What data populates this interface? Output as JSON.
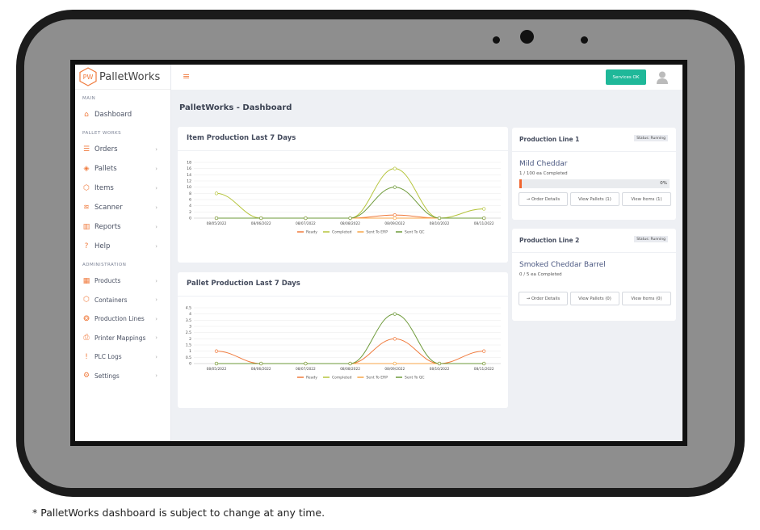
{
  "app": {
    "brand": "PalletWorks",
    "logo_letters": "PW",
    "page_title": "PalletWorks - Dashboard",
    "services_status": "Services OK"
  },
  "sidebar": {
    "sections": [
      {
        "label": "MAIN",
        "items": [
          {
            "label": "Dashboard",
            "icon": "home-icon",
            "glyph": "⌂"
          }
        ]
      },
      {
        "label": "PALLET WORKS",
        "items": [
          {
            "label": "Orders",
            "icon": "orders-icon",
            "glyph": "☰"
          },
          {
            "label": "Pallets",
            "icon": "layers-icon",
            "glyph": "◈"
          },
          {
            "label": "Items",
            "icon": "box-icon",
            "glyph": "⬡"
          },
          {
            "label": "Scanner",
            "icon": "rss-icon",
            "glyph": "≋"
          },
          {
            "label": "Reports",
            "icon": "bar-chart-icon",
            "glyph": "▥"
          },
          {
            "label": "Help",
            "icon": "help-icon",
            "glyph": "?"
          }
        ]
      },
      {
        "label": "ADMINISTRATION",
        "items": [
          {
            "label": "Products",
            "icon": "grid-icon",
            "glyph": "▦"
          },
          {
            "label": "Containers",
            "icon": "box-icon",
            "glyph": "⬡"
          },
          {
            "label": "Production Lines",
            "icon": "globe-icon",
            "glyph": "❂"
          },
          {
            "label": "Printer Mappings",
            "icon": "printer-icon",
            "glyph": "⎙"
          },
          {
            "label": "PLC Logs",
            "icon": "alert-icon",
            "glyph": "!"
          },
          {
            "label": "Settings",
            "icon": "gear-icon",
            "glyph": "⚙"
          }
        ]
      }
    ]
  },
  "chart_data": [
    {
      "type": "line",
      "title": "Item Production Last 7 Days",
      "categories": [
        "08/05/2022",
        "08/06/2022",
        "08/07/2022",
        "08/08/2022",
        "08/09/2022",
        "08/10/2022",
        "08/11/2022"
      ],
      "ylim": [
        0,
        18
      ],
      "yticks": [
        0,
        2,
        4,
        6,
        8,
        10,
        12,
        14,
        16,
        18
      ],
      "grid": true,
      "legend": "bottom",
      "series": [
        {
          "name": "Ready",
          "color": "#f07a3c",
          "values": [
            0,
            0,
            0,
            0,
            1,
            0,
            0
          ]
        },
        {
          "name": "Completed",
          "color": "#b5c43c",
          "values": [
            8,
            0,
            0,
            0,
            16,
            0,
            3
          ]
        },
        {
          "name": "Sent To ERP",
          "color": "#f7a648",
          "values": [
            0,
            0,
            0,
            0,
            0,
            0,
            0
          ]
        },
        {
          "name": "Sent To QC",
          "color": "#6e9a3a",
          "values": [
            0,
            0,
            0,
            0,
            10,
            0,
            0
          ]
        }
      ]
    },
    {
      "type": "line",
      "title": "Pallet Production Last 7 Days",
      "categories": [
        "08/05/2022",
        "08/06/2022",
        "08/07/2022",
        "08/08/2022",
        "08/09/2022",
        "08/10/2022",
        "08/11/2022"
      ],
      "ylim": [
        0,
        4.5
      ],
      "yticks": [
        0,
        0.5,
        1,
        1.5,
        2,
        2.5,
        3,
        3.5,
        4,
        4.5
      ],
      "grid": true,
      "legend": "bottom",
      "series": [
        {
          "name": "Ready",
          "color": "#f07a3c",
          "values": [
            1,
            0,
            0,
            0,
            2,
            0,
            1
          ]
        },
        {
          "name": "Completed",
          "color": "#b5c43c",
          "values": [
            0,
            0,
            0,
            0,
            0,
            0,
            0
          ]
        },
        {
          "name": "Sent To ERP",
          "color": "#f7a648",
          "values": [
            0,
            0,
            0,
            0,
            0,
            0,
            0
          ]
        },
        {
          "name": "Sent To QC",
          "color": "#6e9a3a",
          "values": [
            0,
            0,
            0,
            0,
            4,
            0,
            0
          ]
        }
      ]
    }
  ],
  "lines": [
    {
      "title": "Production Line 1",
      "status": "Status: Running",
      "product": "Mild Cheddar",
      "count": "1 / 100 ea Completed",
      "progress_pct": 0,
      "progress_label": "0%",
      "btn_order": "→ Order Details",
      "btn_pallets": "View Pallets (1)",
      "btn_items": "View Items (1)"
    },
    {
      "title": "Production Line 2",
      "status": "Status: Running",
      "product": "Smoked Cheddar Barrel",
      "count": "0 / 5 ea Completed",
      "btn_order": "→ Order Details",
      "btn_pallets": "View Pallets (0)",
      "btn_items": "View Items (0)"
    }
  ],
  "caption": "* PalletWorks dashboard is subject to change at any time."
}
